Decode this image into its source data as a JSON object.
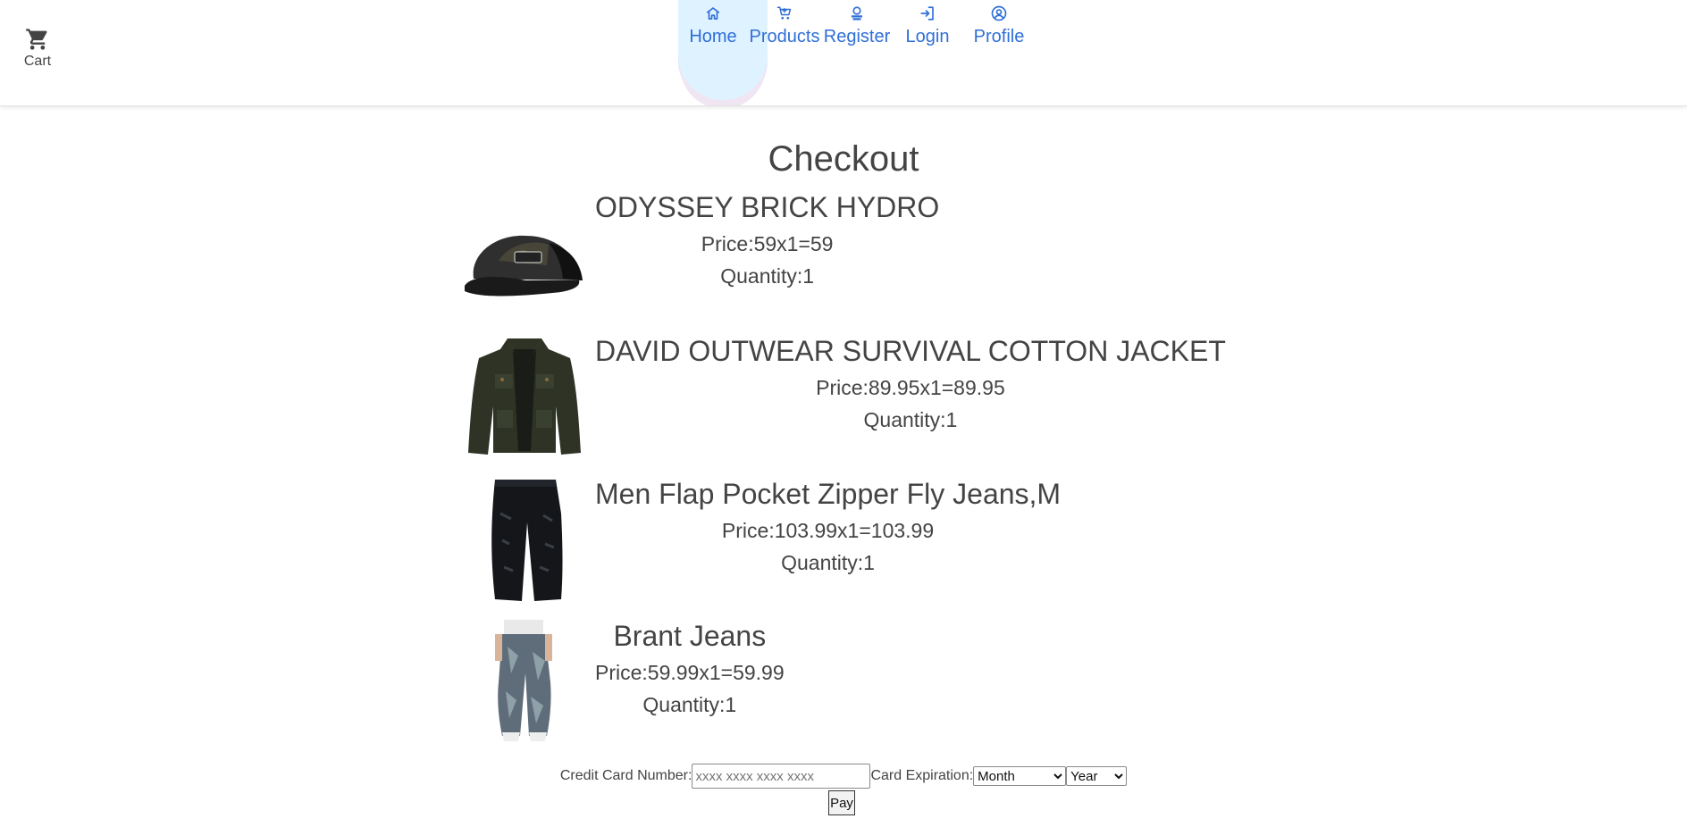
{
  "header": {
    "cart_label": "Cart",
    "nav": [
      {
        "label": "Home",
        "icon": "home-icon"
      },
      {
        "label": "Products",
        "icon": "cart-plus-icon"
      },
      {
        "label": "Register",
        "icon": "register-icon"
      },
      {
        "label": "Login",
        "icon": "login-icon"
      },
      {
        "label": "Profile",
        "icon": "user-circle-icon"
      }
    ],
    "active_nav": "Home",
    "accent_color": "#2f6fd8"
  },
  "page": {
    "title": "Checkout"
  },
  "items": [
    {
      "name": "ODYSSEY BRICK HYDRO",
      "price": "Price:59x1=59",
      "quantity": "Quantity:1",
      "image": "cap"
    },
    {
      "name": "DAVID OUTWEAR SURVIVAL COTTON JACKET",
      "price": "Price:89.95x1=89.95",
      "quantity": "Quantity:1",
      "image": "jacket"
    },
    {
      "name": "Men Flap Pocket Zipper Fly Jeans,M",
      "price": "Price:103.99x1=103.99",
      "quantity": "Quantity:1",
      "image": "black-jeans"
    },
    {
      "name": "Brant Jeans",
      "price": "Price:59.99x1=59.99",
      "quantity": "Quantity:1",
      "image": "blue-jeans"
    }
  ],
  "payment": {
    "card_label": "Credit Card Number:",
    "card_placeholder": "xxxx xxxx xxxx xxxx",
    "card_value": "",
    "expiration_label": "Card Expiration:",
    "month_selected": "Month",
    "year_selected": "Year",
    "pay_label": "Pay"
  }
}
